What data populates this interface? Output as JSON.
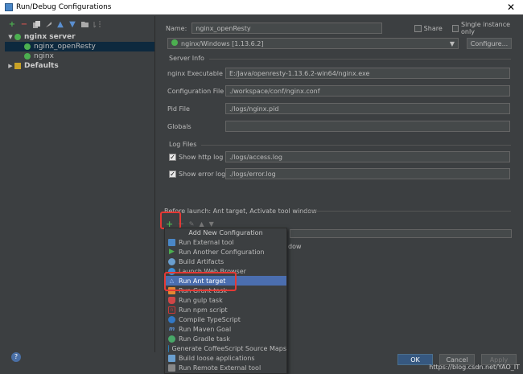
{
  "window": {
    "title": "Run/Debug Configurations",
    "close": "✕"
  },
  "left_toolbar": {
    "add": "+",
    "remove": "−"
  },
  "tree": {
    "group": "nginx server",
    "item1": "nginx_openResty",
    "item2": "nginx",
    "defaults": "Defaults"
  },
  "form": {
    "name_label": "Name:",
    "name_value": "nginx_openResty",
    "share_label": "Share",
    "single_instance_label": "Single instance only",
    "nginx_version": "nginx/Windows [1.13.6.2]",
    "configure_button": "Configure...",
    "server_info_title": "Server Info",
    "exec_label": "nginx Executable",
    "exec_value": "E:/Java/openresty-1.13.6.2-win64/nginx.exe",
    "conf_label": "Configuration File",
    "conf_value": "./workspace/conf/nginx.conf",
    "pid_label": "Pid File",
    "pid_value": "./logs/nginx.pid",
    "globals_label": "Globals",
    "log_title": "Log Files",
    "http_log_label": "Show http log",
    "http_log_value": "./logs/access.log",
    "error_log_label": "Show error log",
    "error_log_value": "./logs/error.log",
    "before_launch": "Before launch: Ant target, Activate tool window",
    "add_icon": "+",
    "activate_partial": "dow"
  },
  "popup": {
    "header": "Add New Configuration",
    "items": [
      "Run External tool",
      "Run Another Configuration",
      "Build Artifacts",
      "Launch Web Browser",
      "Run Ant target",
      "Run Grunt task",
      "Run gulp task",
      "Run npm script",
      "Compile TypeScript",
      "Run Maven Goal",
      "Run Gradle task",
      "Generate CoffeeScript Source Maps",
      "Build loose applications",
      "Run Remote External tool"
    ]
  },
  "buttons": {
    "ok": "OK",
    "cancel": "Cancel",
    "apply": "Apply"
  },
  "help": "?",
  "watermark": "https://blog.csdn.net/YAO_IT",
  "colors": {
    "bg": "#3c3f41",
    "selection": "#4b6eaf",
    "annotation": "#e53935"
  }
}
